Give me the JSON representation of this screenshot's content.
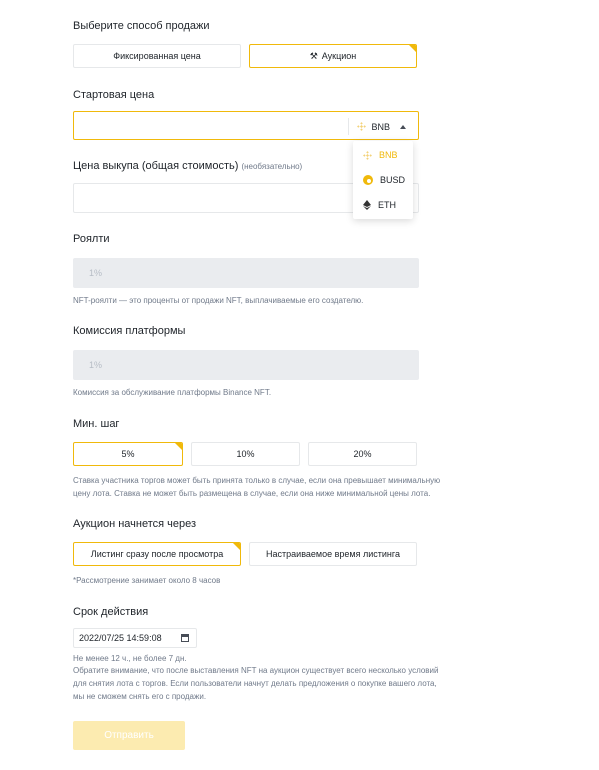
{
  "sale_method": {
    "label": "Выберите способ продажи",
    "options": [
      "Фиксированная цена",
      "Аукцион"
    ],
    "selected": "Аукцион"
  },
  "start_price": {
    "label": "Стартовая цена",
    "value": "",
    "currency": "BNB",
    "currency_options": [
      "BNB",
      "BUSD",
      "ETH"
    ]
  },
  "buyout": {
    "label": "Цена выкупа (общая стоимость)",
    "optional": "(необязательно)",
    "value": ""
  },
  "royalty": {
    "label": "Роялти",
    "value": "1%",
    "hint": "NFT-роялти — это проценты от продажи NFT, выплачиваемые его создателю."
  },
  "fee": {
    "label": "Комиссия платформы",
    "value": "1%",
    "hint": "Комиссия за обслуживание платформы Binance NFT."
  },
  "min_step": {
    "label": "Мин. шаг",
    "options": [
      "5%",
      "10%",
      "20%"
    ],
    "selected": "5%",
    "hint_line1": "Ставка участника торгов может быть принята только в случае, если она превышает минимальную",
    "hint_line2": "цену лота. Ставка не может быть размещена в случае, если она ниже минимальной цены лота."
  },
  "auction_start": {
    "label": "Аукцион начнется через",
    "options": [
      "Листинг сразу после просмотра",
      "Настраиваемое время листинга"
    ],
    "selected": "Листинг сразу после просмотра",
    "hint": "*Рассмотрение занимает около 8 часов"
  },
  "duration": {
    "label": "Срок действия",
    "value": "2022/07/25 14:59:08",
    "hint_line1": "Не менее 12 ч., не более 7 дн.",
    "hint_line2": "Обратите внимание, что после выставления NFT на аукцион существует всего несколько условий",
    "hint_line3": "для снятия лота с торгов. Если пользователи начнут делать предложения о покупке вашего лота,",
    "hint_line4": "мы не сможем снять его с продажи."
  },
  "submit_label": "Отправить",
  "colors": {
    "accent": "#f0b90b",
    "disabled_bg": "#eaecef",
    "submit_disabled": "#fcebb0"
  }
}
